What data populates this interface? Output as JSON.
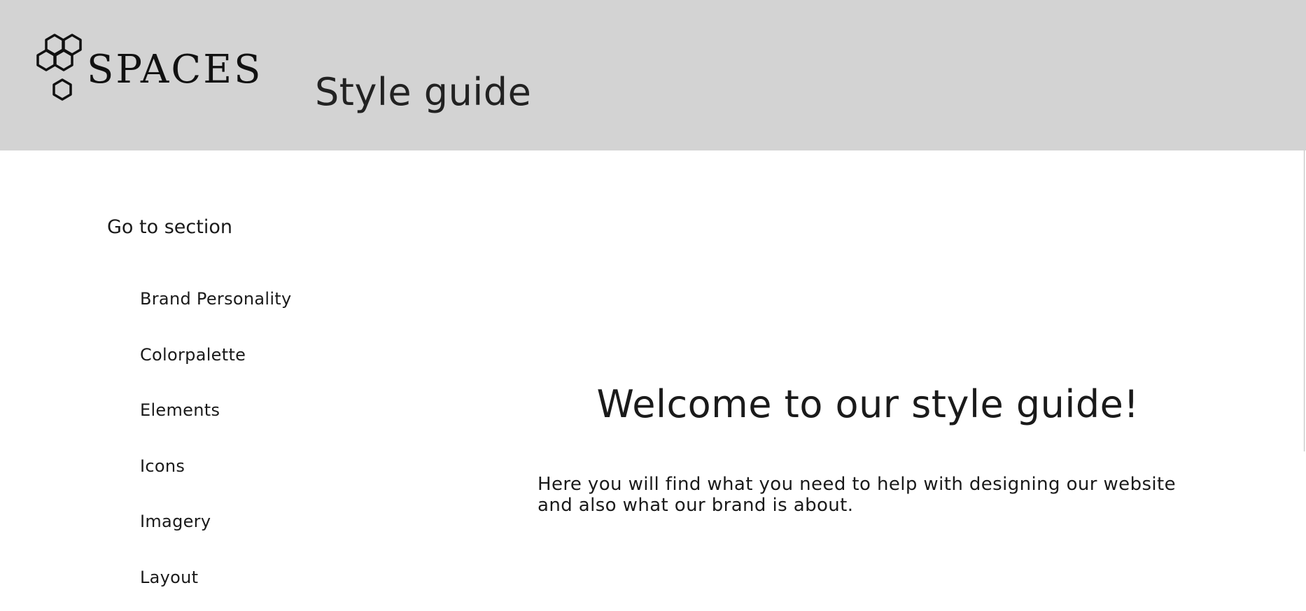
{
  "header": {
    "logo_text": "SPACES",
    "logo_icon": "hexagon-cluster-icon",
    "title": "Style guide",
    "background": "#d3d3d3"
  },
  "sidebar": {
    "heading": "Go to section",
    "items": [
      {
        "label": "Brand Personality"
      },
      {
        "label": "Colorpalette"
      },
      {
        "label": "Elements"
      },
      {
        "label": "Icons"
      },
      {
        "label": "Imagery"
      },
      {
        "label": "Layout"
      }
    ]
  },
  "main": {
    "welcome": "Welcome to our style guide!",
    "intro": "Here you will find what you need to help with designing our website and also what our brand is about."
  }
}
